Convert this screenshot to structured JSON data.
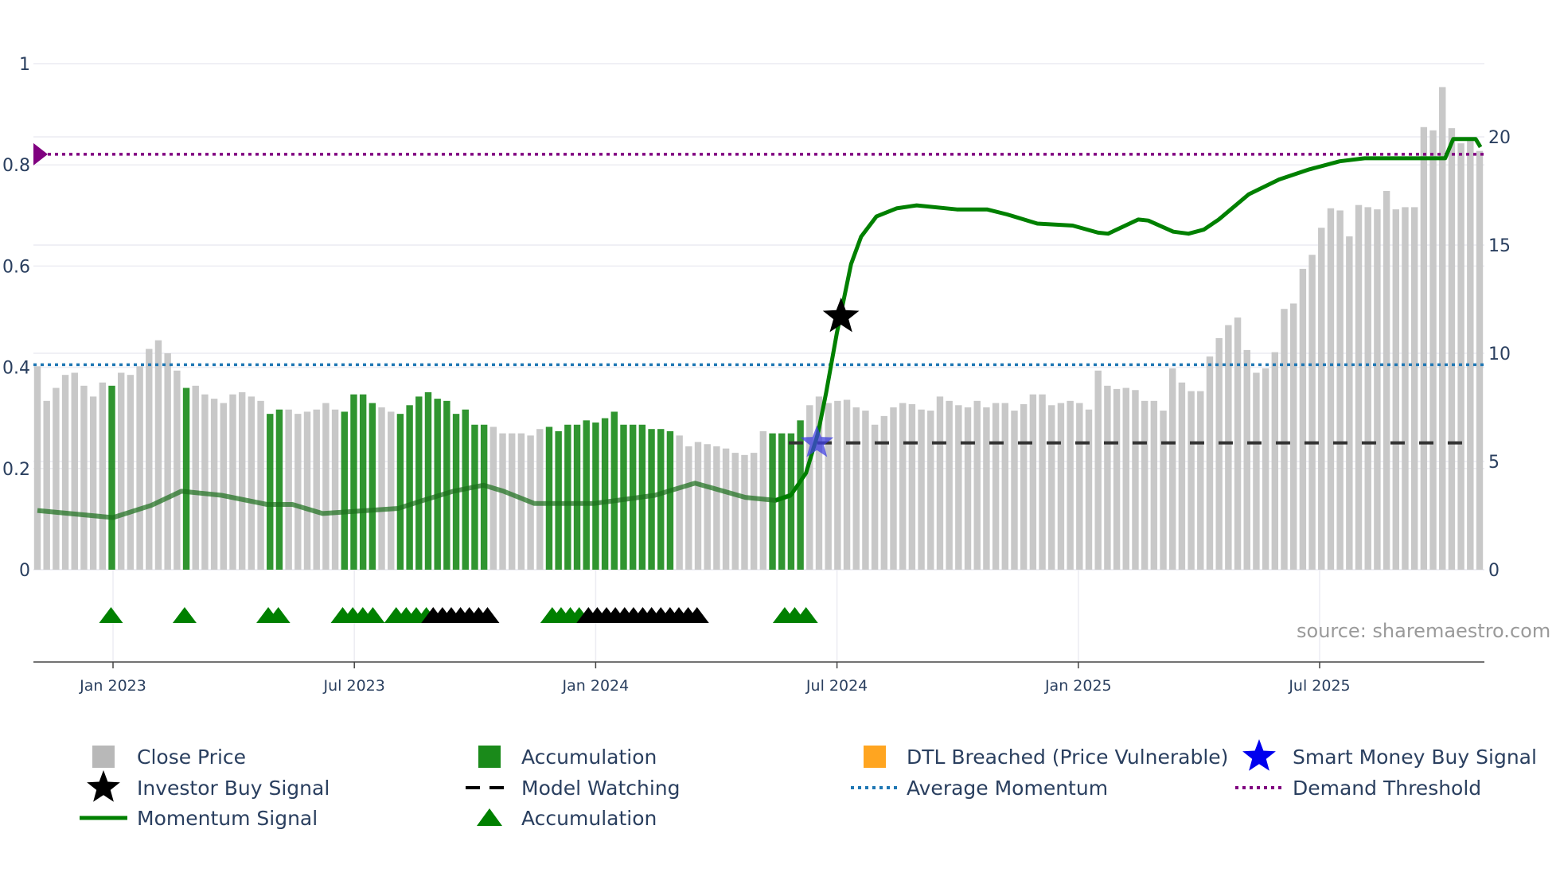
{
  "chart_data": {
    "type": "bar",
    "title": "",
    "source_note": "source: sharemaestro.com",
    "x_axis": {
      "type": "date",
      "unit": "months since Jan 2023",
      "ticks": [
        {
          "m": 0,
          "label": "Jan 2023"
        },
        {
          "m": 6,
          "label": "Jul 2023"
        },
        {
          "m": 12,
          "label": "Jan 2024"
        },
        {
          "m": 18,
          "label": "Jul 2024"
        },
        {
          "m": 24,
          "label": "Jan 2025"
        },
        {
          "m": 30,
          "label": "Jul 2025"
        }
      ]
    },
    "left_axis": {
      "range": [
        0,
        1
      ],
      "ticks": [
        "0",
        "0.2",
        "0.4",
        "0.6",
        "0.8",
        "1"
      ],
      "tick_values": [
        0,
        0.2,
        0.4,
        0.6,
        0.8,
        1
      ]
    },
    "right_axis": {
      "range": [
        0,
        20
      ],
      "ticks": [
        "0",
        "5",
        "10",
        "15",
        "20"
      ],
      "tick_values": [
        0,
        5,
        10,
        15,
        20
      ]
    },
    "close_price_bars": {
      "note": "weekly close price on right axis; type n=normal, g=accumulation, o=DTL breached",
      "values": [
        9.4,
        7.8,
        8.4,
        9.0,
        9.1,
        8.5,
        8.0,
        8.65,
        8.5,
        9.1,
        9.0,
        9.4,
        10.2,
        10.6,
        10.0,
        9.2,
        8.4,
        8.5,
        8.1,
        7.9,
        7.7,
        8.1,
        8.2,
        8.0,
        7.8,
        7.2,
        7.4,
        7.4,
        7.2,
        7.3,
        7.4,
        7.7,
        7.4,
        7.3,
        8.1,
        8.1,
        7.7,
        7.5,
        7.3,
        7.2,
        7.6,
        8.0,
        8.2,
        7.9,
        7.8,
        7.2,
        7.4,
        6.7,
        6.7,
        6.6,
        6.3,
        6.3,
        6.3,
        6.2,
        6.5,
        6.6,
        6.4,
        6.7,
        6.7,
        6.9,
        6.8,
        7.0,
        7.3,
        6.7,
        6.7,
        6.7,
        6.5,
        6.5,
        6.4,
        6.2,
        5.7,
        5.9,
        5.8,
        5.7,
        5.6,
        5.4,
        5.3,
        5.4,
        6.4,
        6.3,
        6.3,
        6.3,
        6.9,
        7.6,
        8.0,
        7.7,
        7.8,
        7.85,
        7.5,
        7.35,
        6.7,
        7.1,
        7.5,
        7.7,
        7.65,
        7.4,
        7.35,
        8.0,
        7.8,
        7.6,
        7.5,
        7.8,
        7.5,
        7.7,
        7.7,
        7.35,
        7.65,
        8.1,
        8.1,
        7.6,
        7.7,
        7.8,
        7.7,
        7.4,
        9.2,
        8.5,
        8.35,
        8.4,
        8.3,
        7.8,
        7.8,
        7.35,
        9.3,
        8.65,
        8.25,
        8.25,
        9.85,
        10.7,
        11.3,
        11.65,
        10.15,
        9.1,
        9.3,
        10.05,
        12.05,
        12.3,
        13.9,
        14.55,
        15.8,
        16.7,
        16.6,
        15.4,
        16.85,
        16.75,
        16.65,
        17.5,
        16.65,
        16.75,
        16.75,
        20.45,
        20.3,
        22.3,
        20.4,
        19.7,
        19.9,
        19.35
      ],
      "types": "nnnnnnnngnnnnnnngnnnnnnnnggnnnnnnggggnnggggggggggnnnnnnggggggggggggggnnnnnnnnnnggggnnnnnnnnnnnnnnnnnnnnnnnnnnnnnnnnnnnnnnnnnnnnnnnnnnnnnnnnnnnnnnnnnnnnnnnnnnnooooooo"
    },
    "momentum_signal": {
      "axis": "left",
      "points": [
        [
          -1.88,
          0.117
        ],
        [
          0,
          0.103
        ],
        [
          0.95,
          0.127
        ],
        [
          1.7,
          0.155
        ],
        [
          2.7,
          0.147
        ],
        [
          3.83,
          0.129
        ],
        [
          4.46,
          0.129
        ],
        [
          5.21,
          0.111
        ],
        [
          7.09,
          0.121
        ],
        [
          7.71,
          0.137
        ],
        [
          8.46,
          0.155
        ],
        [
          9.21,
          0.167
        ],
        [
          9.71,
          0.155
        ],
        [
          10.47,
          0.131
        ],
        [
          11.97,
          0.131
        ],
        [
          13.47,
          0.147
        ],
        [
          14.47,
          0.171
        ],
        [
          15.72,
          0.143
        ],
        [
          16.47,
          0.137
        ],
        [
          16.85,
          0.147
        ],
        [
          17.23,
          0.191
        ],
        [
          17.53,
          0.27
        ],
        [
          17.73,
          0.35
        ],
        [
          18.0,
          0.469
        ],
        [
          18.35,
          0.604
        ],
        [
          18.6,
          0.658
        ],
        [
          18.98,
          0.698
        ],
        [
          19.48,
          0.714
        ],
        [
          19.98,
          0.72
        ],
        [
          20.98,
          0.712
        ],
        [
          21.73,
          0.712
        ],
        [
          22.23,
          0.702
        ],
        [
          22.98,
          0.684
        ],
        [
          23.86,
          0.68
        ],
        [
          24.49,
          0.666
        ],
        [
          24.74,
          0.664
        ],
        [
          25.49,
          0.692
        ],
        [
          25.74,
          0.69
        ],
        [
          26.36,
          0.668
        ],
        [
          26.74,
          0.664
        ],
        [
          27.12,
          0.672
        ],
        [
          27.49,
          0.692
        ],
        [
          28.24,
          0.742
        ],
        [
          28.99,
          0.771
        ],
        [
          29.74,
          0.791
        ],
        [
          30.5,
          0.807
        ],
        [
          31.12,
          0.813
        ],
        [
          33.12,
          0.813
        ],
        [
          33.32,
          0.851
        ],
        [
          33.88,
          0.851
        ],
        [
          34.0,
          0.835
        ]
      ],
      "faded_before_month": 16.85
    },
    "average_momentum": 0.405,
    "demand_threshold": 0.821,
    "model_watching": {
      "price": 5.86,
      "from_month": 16.8,
      "to_month": 33.75
    },
    "investor_buy_signal": {
      "month": 18.1,
      "value": 0.5
    },
    "smart_money_buy_signal": {
      "month": 17.5,
      "price": 5.86
    },
    "accumulation_markers": {
      "green": [
        -0.05,
        1.78,
        3.86,
        4.11,
        5.71,
        5.96,
        6.21,
        6.46,
        7.04,
        7.29,
        7.54,
        7.79,
        10.92,
        11.14,
        11.37,
        11.59,
        16.7,
        16.95,
        17.23
      ],
      "black": [
        7.96,
        8.19,
        8.41,
        8.64,
        8.86,
        9.09,
        9.31,
        11.82,
        12.04,
        12.27,
        12.49,
        12.72,
        12.94,
        13.17,
        13.39,
        13.62,
        13.85,
        14.07,
        14.3,
        14.52
      ]
    },
    "legend": [
      {
        "label": "Close Price",
        "icon": "square",
        "color": "#b8b8b8"
      },
      {
        "label": "Accumulation",
        "icon": "square",
        "color": "#1a8a1a"
      },
      {
        "label": "DTL Breached (Price Vulnerable)",
        "icon": "square",
        "color": "#ffa520"
      },
      {
        "label": "Smart Money Buy Signal",
        "icon": "star",
        "color": "#0000ee"
      },
      {
        "label": "Investor Buy Signal",
        "icon": "star",
        "color": "#000000"
      },
      {
        "label": "Model Watching",
        "icon": "dash",
        "color": "#000000"
      },
      {
        "label": "Average Momentum",
        "icon": "dot",
        "color": "#1f77b4"
      },
      {
        "label": "Demand Threshold",
        "icon": "dot",
        "color": "#800080"
      },
      {
        "label": "Momentum Signal",
        "icon": "line",
        "color": "#008000"
      },
      {
        "label": "Accumulation",
        "icon": "triangle",
        "color": "#008000"
      }
    ],
    "colors": {
      "normal": "#c8c8c8",
      "accumulation": "#1a8a1a",
      "dtl": "#ffc870",
      "momentum": "#008000",
      "avg": "#1f77b4",
      "demand": "#800080"
    }
  }
}
